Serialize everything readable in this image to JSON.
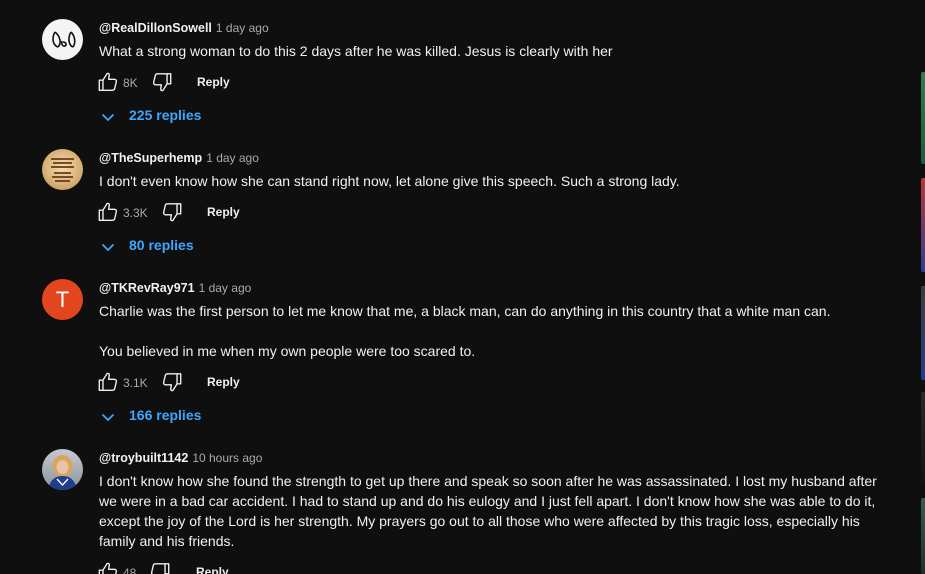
{
  "comments": [
    {
      "handle": "@RealDillonSowell",
      "time": "1 day ago",
      "avatar": "dillon-logo",
      "paragraphs": [
        "What a strong woman to do this 2 days after he was killed. Jesus is clearly with her"
      ],
      "likes": "8K",
      "reply_label": "Reply",
      "replies_label": "225 replies"
    },
    {
      "handle": "@TheSuperhemp",
      "time": "1 day ago",
      "avatar": "hemp-badge",
      "paragraphs": [
        "I don't even know how she can stand right now,  let alone give this speech. Such a strong lady."
      ],
      "likes": "3.3K",
      "reply_label": "Reply",
      "replies_label": "80 replies"
    },
    {
      "handle": "@TKRevRay971",
      "time": "1 day ago",
      "avatar_letter": "T",
      "avatar_color": "#e2461f",
      "paragraphs": [
        "Charlie was the first person to let me know that me, a black man, can do anything in this country that a white man can.",
        "You believed in me when my own people were too scared to."
      ],
      "likes": "3.1K",
      "reply_label": "Reply",
      "replies_label": "166 replies"
    },
    {
      "handle": "@troybuilt1142",
      "time": "10 hours ago",
      "avatar": "profile-photo",
      "paragraphs": [
        "I don't know how she found the strength to get up there and speak so soon after he was assassinated. I lost my husband after we were in a bad car accident. I had to stand up and do his eulogy and I just fell apart. I don't know how she was able to do it, except the joy of the Lord is her strength. My prayers go out to all those who were affected by this tragic loss, especially his family and his friends."
      ],
      "likes": "48",
      "reply_label": "Reply"
    }
  ],
  "icons": {
    "like": "thumb-up-outline-icon",
    "dislike": "thumb-down-outline-icon",
    "expand": "chevron-down-icon"
  },
  "colors": {
    "background": "#0f0f0f",
    "text": "#f1f1f1",
    "secondary_text": "#aaaaaa",
    "link": "#3ea6ff"
  }
}
